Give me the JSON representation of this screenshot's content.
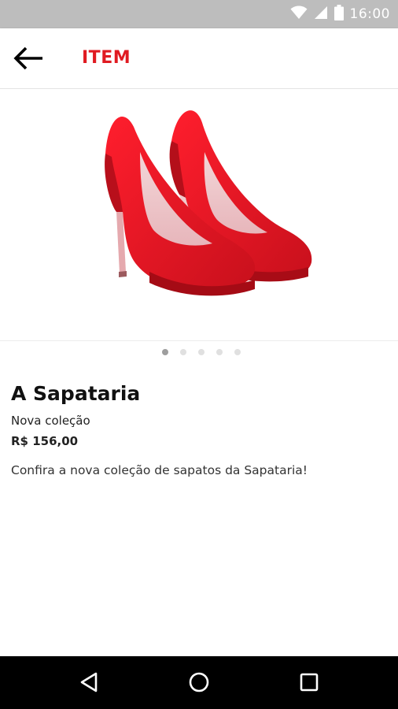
{
  "status_bar": {
    "time": "16:00",
    "icons": [
      "wifi-icon",
      "signal-icon",
      "battery-icon"
    ]
  },
  "app_bar": {
    "title": "ITEM",
    "back_icon": "arrow-back-icon",
    "title_color": "#e01b22"
  },
  "carousel": {
    "image_subject": "red-suede-high-heel-pumps",
    "page_count": 5,
    "active_index": 0
  },
  "product": {
    "store_name": "A Sapataria",
    "collection": "Nova coleção",
    "price": "R$ 156,00",
    "description": "Confira a nova coleção de sapatos da Sapataria!"
  },
  "nav_bar": {
    "buttons": [
      "back-triangle-icon",
      "home-circle-icon",
      "recents-square-icon"
    ]
  }
}
